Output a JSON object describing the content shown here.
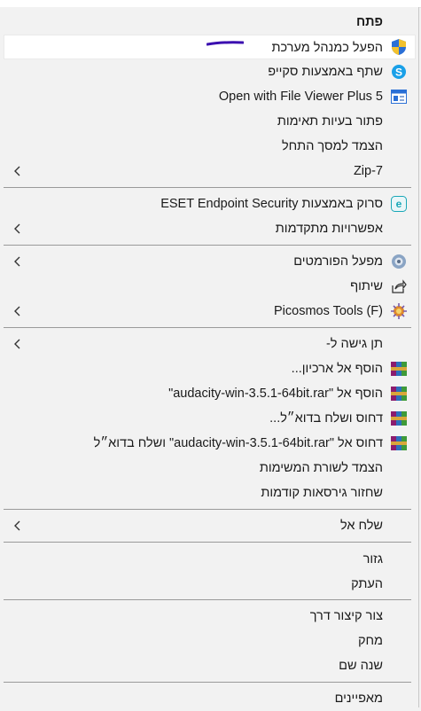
{
  "menu": {
    "items": [
      {
        "label": "פתח",
        "bold": true,
        "icon": null,
        "submenu": false
      },
      {
        "label": "הפעל כמנהל מערכת",
        "icon": "uac-shield-icon",
        "submenu": false,
        "highlighted": true
      },
      {
        "label": "שתף באמצעות סקייפ",
        "icon": "skype-icon",
        "submenu": false
      },
      {
        "label": "Open with File Viewer Plus 5",
        "icon": "file-viewer-icon",
        "submenu": false
      },
      {
        "label": "פתור בעיות תאימות",
        "icon": null,
        "submenu": false
      },
      {
        "label": "הצמד למסך התחל",
        "icon": null,
        "submenu": false
      },
      {
        "label": "Zip-7",
        "icon": null,
        "submenu": true
      },
      {
        "label": "סרוק באמצעות ESET Endpoint Security",
        "icon": "eset-icon",
        "submenu": false
      },
      {
        "label": "אפשרויות מתקדמות",
        "icon": null,
        "submenu": true
      },
      {
        "label": "מפעל הפורמטים",
        "icon": "format-factory-icon",
        "submenu": true
      },
      {
        "label": "שיתוף",
        "icon": "share-icon",
        "submenu": false
      },
      {
        "label": "Picosmos Tools (F)",
        "icon": "picosmos-icon",
        "submenu": true
      },
      {
        "label": "תן גישה ל-",
        "icon": null,
        "submenu": true
      },
      {
        "label": "הוסף אל ארכיון...",
        "icon": "winrar-icon",
        "submenu": false
      },
      {
        "label": "הוסף אל \"audacity-win-3.5.1-64bit.rar\"",
        "icon": "winrar-icon",
        "submenu": false
      },
      {
        "label": "דחוס ושלח בדוא״ל...",
        "icon": "winrar-icon",
        "submenu": false
      },
      {
        "label": "דחוס אל \"audacity-win-3.5.1-64bit.rar\" ושלח בדוא״ל",
        "icon": "winrar-icon",
        "submenu": false
      },
      {
        "label": "הצמד לשורת המשימות",
        "icon": null,
        "submenu": false
      },
      {
        "label": "שחזור גירסאות קודמות",
        "icon": null,
        "submenu": false
      },
      {
        "label": "שלח אל",
        "icon": null,
        "submenu": true
      },
      {
        "label": "גזור",
        "icon": null,
        "submenu": false
      },
      {
        "label": "העתק",
        "icon": null,
        "submenu": false
      },
      {
        "label": "צור קיצור דרך",
        "icon": null,
        "submenu": false
      },
      {
        "label": "מחק",
        "icon": null,
        "submenu": false
      },
      {
        "label": "שנה שם",
        "icon": null,
        "submenu": false
      },
      {
        "label": "מאפיינים",
        "icon": null,
        "submenu": false
      }
    ]
  },
  "colors": {
    "menu_bg": "#f2f2f2",
    "highlight_bg": "#ffffff",
    "separator": "#9a9a9a",
    "annotation_mark": "#3b0fb0"
  }
}
